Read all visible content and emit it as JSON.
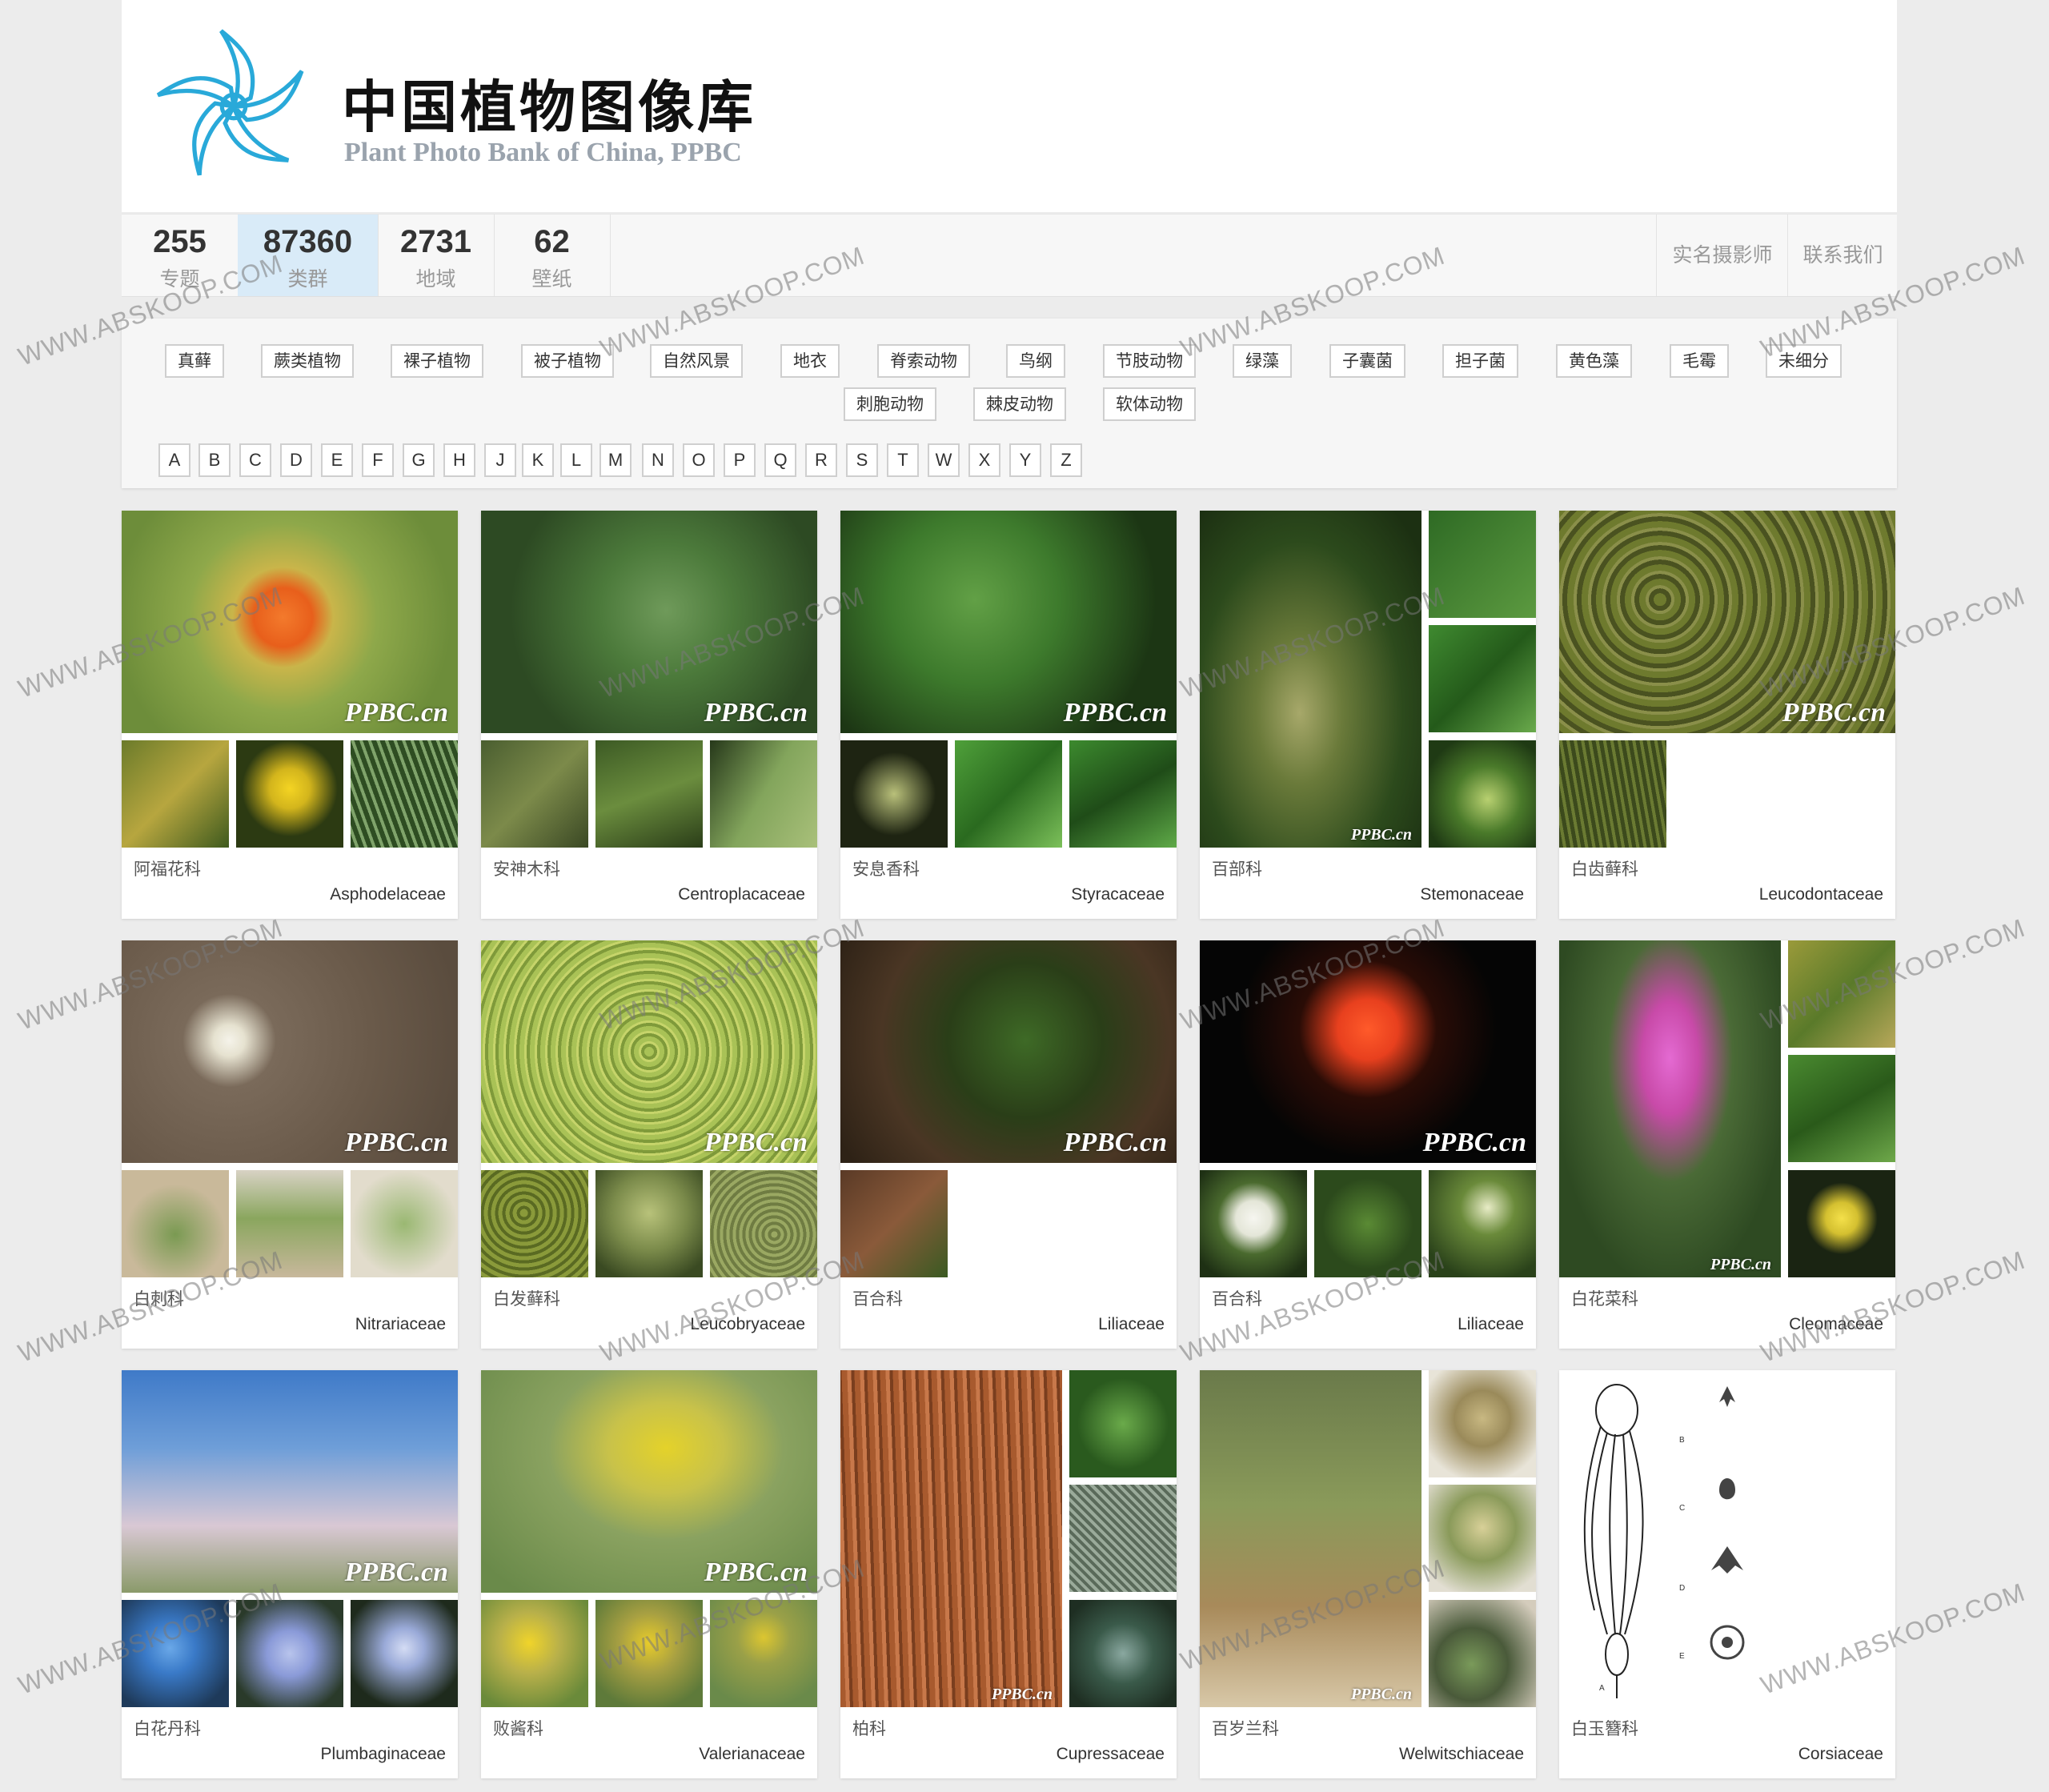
{
  "site": {
    "title": "中国植物图像库",
    "subtitle": "Plant Photo Bank of China,   PPBC",
    "accent": "#29a9d9"
  },
  "stats": [
    {
      "num": "255",
      "label": "专题"
    },
    {
      "num": "87360",
      "label": "类群",
      "active": true
    },
    {
      "num": "2731",
      "label": "地域"
    },
    {
      "num": "62",
      "label": "壁纸"
    }
  ],
  "top_links": [
    "实名摄影师",
    "联系我们"
  ],
  "categories": [
    "真藓",
    "蕨类植物",
    "裸子植物",
    "被子植物",
    "自然风景",
    "地衣",
    "脊索动物",
    "鸟纲",
    "节肢动物",
    "绿藻",
    "子囊菌",
    "担子菌",
    "黄色藻",
    "毛霉",
    "未细分",
    "刺胞动物",
    "棘皮动物",
    "软体动物"
  ],
  "letters": [
    "A",
    "B",
    "C",
    "D",
    "E",
    "F",
    "G",
    "H",
    "J",
    "K",
    "L",
    "M",
    "N",
    "O",
    "P",
    "Q",
    "R",
    "S",
    "T",
    "W",
    "X",
    "Y",
    "Z"
  ],
  "photo_watermark": "PPBC.cn",
  "site_watermark": "WWW.ABSKOOP.COM",
  "families": [
    {
      "cn": "阿福花科",
      "latin": "Asphodelaceae"
    },
    {
      "cn": "安神木科",
      "latin": "Centroplacaceae"
    },
    {
      "cn": "安息香科",
      "latin": "Styracaceae"
    },
    {
      "cn": "百部科",
      "latin": "Stemonaceae"
    },
    {
      "cn": "白齿藓科",
      "latin": "Leucodontaceae"
    },
    {
      "cn": "白刺科",
      "latin": "Nitrariaceae"
    },
    {
      "cn": "白发藓科",
      "latin": "Leucobryaceae"
    },
    {
      "cn": "百合科",
      "latin": "Liliaceae"
    },
    {
      "cn": "百合科",
      "latin": "Liliaceae"
    },
    {
      "cn": "白花菜科",
      "latin": "Cleomaceae"
    },
    {
      "cn": "白花丹科",
      "latin": "Plumbaginaceae"
    },
    {
      "cn": "败酱科",
      "latin": "Valerianaceae"
    },
    {
      "cn": "柏科",
      "latin": "Cupressaceae"
    },
    {
      "cn": "百岁兰科",
      "latin": "Welwitschiaceae"
    },
    {
      "cn": "白玉簪科",
      "latin": "Corsiaceae"
    }
  ]
}
